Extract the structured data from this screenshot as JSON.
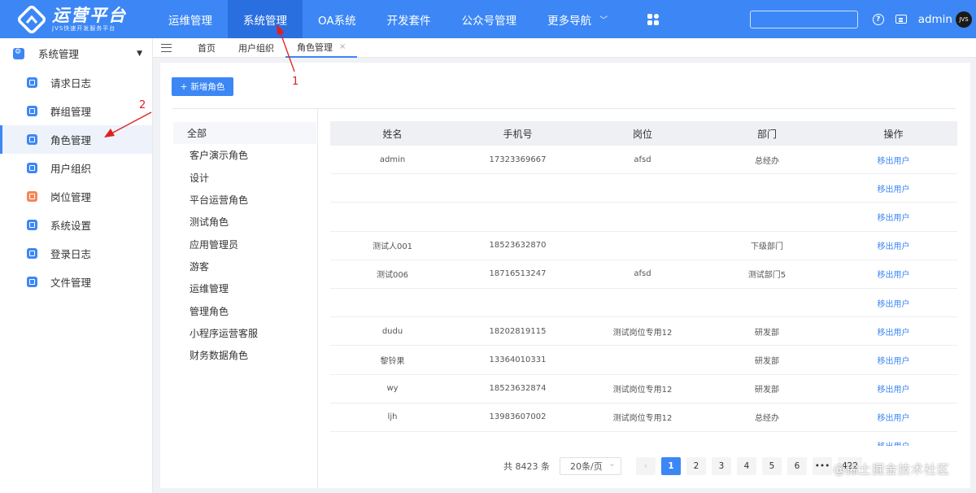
{
  "header": {
    "logo_title": "运营平台",
    "logo_subtitle": "JVS快速开发服务平台",
    "nav": [
      "运维管理",
      "系统管理",
      "OA系统",
      "开发套件",
      "公众号管理",
      "更多导航"
    ],
    "active_nav": "系统管理",
    "username": "admin",
    "avatar_text": "JVS"
  },
  "sidebar": {
    "group": "系统管理",
    "items": [
      "请求日志",
      "群组管理",
      "角色管理",
      "用户组织",
      "岗位管理",
      "系统设置",
      "登录日志",
      "文件管理"
    ],
    "active": "角色管理"
  },
  "tabs": [
    {
      "label": "首页"
    },
    {
      "label": "用户组织"
    },
    {
      "label": "角色管理",
      "close": "×"
    }
  ],
  "main": {
    "add_button": "新增角色",
    "add_icon": "+",
    "roles": [
      "全部",
      "客户演示角色",
      "设计",
      "平台运营角色",
      "测试角色",
      "应用管理员",
      "游客",
      "运维管理",
      "管理角色",
      "小程序运营客服",
      "财务数据角色"
    ],
    "table": {
      "columns": [
        "姓名",
        "手机号",
        "岗位",
        "部门",
        "操作"
      ],
      "rows": [
        {
          "name": "admin",
          "phone": "17323369667",
          "post": "afsd",
          "dept": "总经办",
          "action": "移出用户"
        },
        {
          "name": "",
          "phone": "",
          "post": "",
          "dept": "",
          "action": "移出用户"
        },
        {
          "name": "",
          "phone": "",
          "post": "",
          "dept": "",
          "action": "移出用户"
        },
        {
          "name": "测试人001",
          "phone": "18523632870",
          "post": "",
          "dept": "下级部门",
          "action": "移出用户"
        },
        {
          "name": "测试006",
          "phone": "18716513247",
          "post": "afsd",
          "dept": "测试部门5",
          "action": "移出用户"
        },
        {
          "name": "",
          "phone": "",
          "post": "",
          "dept": "",
          "action": "移出用户"
        },
        {
          "name": "dudu",
          "phone": "18202819115",
          "post": "测试岗位专用12",
          "dept": "研发部",
          "action": "移出用户"
        },
        {
          "name": "黎铃果",
          "phone": "13364010331",
          "post": "",
          "dept": "研发部",
          "action": "移出用户"
        },
        {
          "name": "wy",
          "phone": "18523632874",
          "post": "测试岗位专用12",
          "dept": "研发部",
          "action": "移出用户"
        },
        {
          "name": "ljh",
          "phone": "13983607002",
          "post": "测试岗位专用12",
          "dept": "总经办",
          "action": "移出用户"
        },
        {
          "name": "",
          "phone": "",
          "post": "",
          "dept": "",
          "action": "移出用户"
        }
      ]
    },
    "pagination": {
      "total": "共 8423 条",
      "page_size": "20条/页",
      "prev": "‹",
      "pages": [
        "1",
        "2",
        "3",
        "4",
        "5",
        "6"
      ],
      "ellipsis": "•••",
      "last": "422",
      "current": "1"
    }
  },
  "annotations": {
    "label1": "1",
    "label2": "2",
    "color": "#e02020"
  },
  "watermark": "@稀土掘金技术社区",
  "colors": {
    "primary": "#3c87f5",
    "header_active": "#2a6fe0",
    "orange_icon": "#f5855a"
  }
}
